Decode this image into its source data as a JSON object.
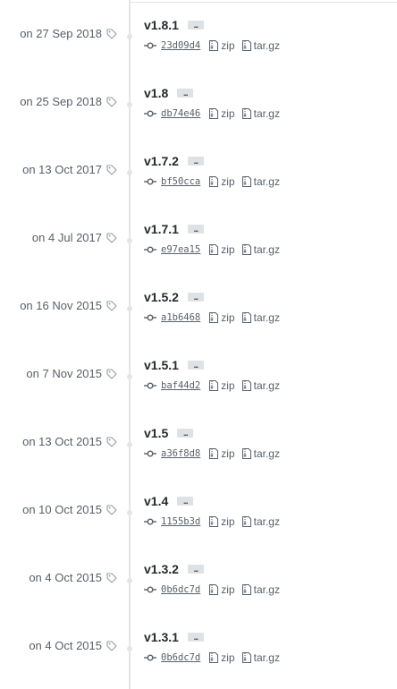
{
  "releases": [
    {
      "date": "on 27 Sep 2018",
      "version": "v1.8.1",
      "more": "...",
      "sha": "23d09d4",
      "zip": "zip",
      "targz": "tar.gz"
    },
    {
      "date": "on 25 Sep 2018",
      "version": "v1.8",
      "more": "...",
      "sha": "db74e46",
      "zip": "zip",
      "targz": "tar.gz"
    },
    {
      "date": "on 13 Oct 2017",
      "version": "v1.7.2",
      "more": "...",
      "sha": "bf50cca",
      "zip": "zip",
      "targz": "tar.gz"
    },
    {
      "date": "on 4 Jul 2017",
      "version": "v1.7.1",
      "more": "...",
      "sha": "e97ea15",
      "zip": "zip",
      "targz": "tar.gz"
    },
    {
      "date": "on 16 Nov 2015",
      "version": "v1.5.2",
      "more": "...",
      "sha": "a1b6468",
      "zip": "zip",
      "targz": "tar.gz"
    },
    {
      "date": "on 7 Nov 2015",
      "version": "v1.5.1",
      "more": "...",
      "sha": "baf44d2",
      "zip": "zip",
      "targz": "tar.gz"
    },
    {
      "date": "on 13 Oct 2015",
      "version": "v1.5",
      "more": "...",
      "sha": "a36f8d8",
      "zip": "zip",
      "targz": "tar.gz"
    },
    {
      "date": "on 10 Oct 2015",
      "version": "v1.4",
      "more": "...",
      "sha": "1155b3d",
      "zip": "zip",
      "targz": "tar.gz"
    },
    {
      "date": "on 4 Oct 2015",
      "version": "v1.3.2",
      "more": "...",
      "sha": "0b6dc7d",
      "zip": "zip",
      "targz": "tar.gz"
    },
    {
      "date": "on 4 Oct 2015",
      "version": "v1.3.1",
      "more": "...",
      "sha": "0b6dc7d",
      "zip": "zip",
      "targz": "tar.gz"
    }
  ],
  "icons": {
    "tag": "tag-icon",
    "commit": "git-commit-icon",
    "archive": "file-zip-icon"
  },
  "colors": {
    "timeline": "#e1e4e8",
    "muted_text": "#586069",
    "title_text": "#24292e",
    "more_button": "#dfe2e5"
  }
}
